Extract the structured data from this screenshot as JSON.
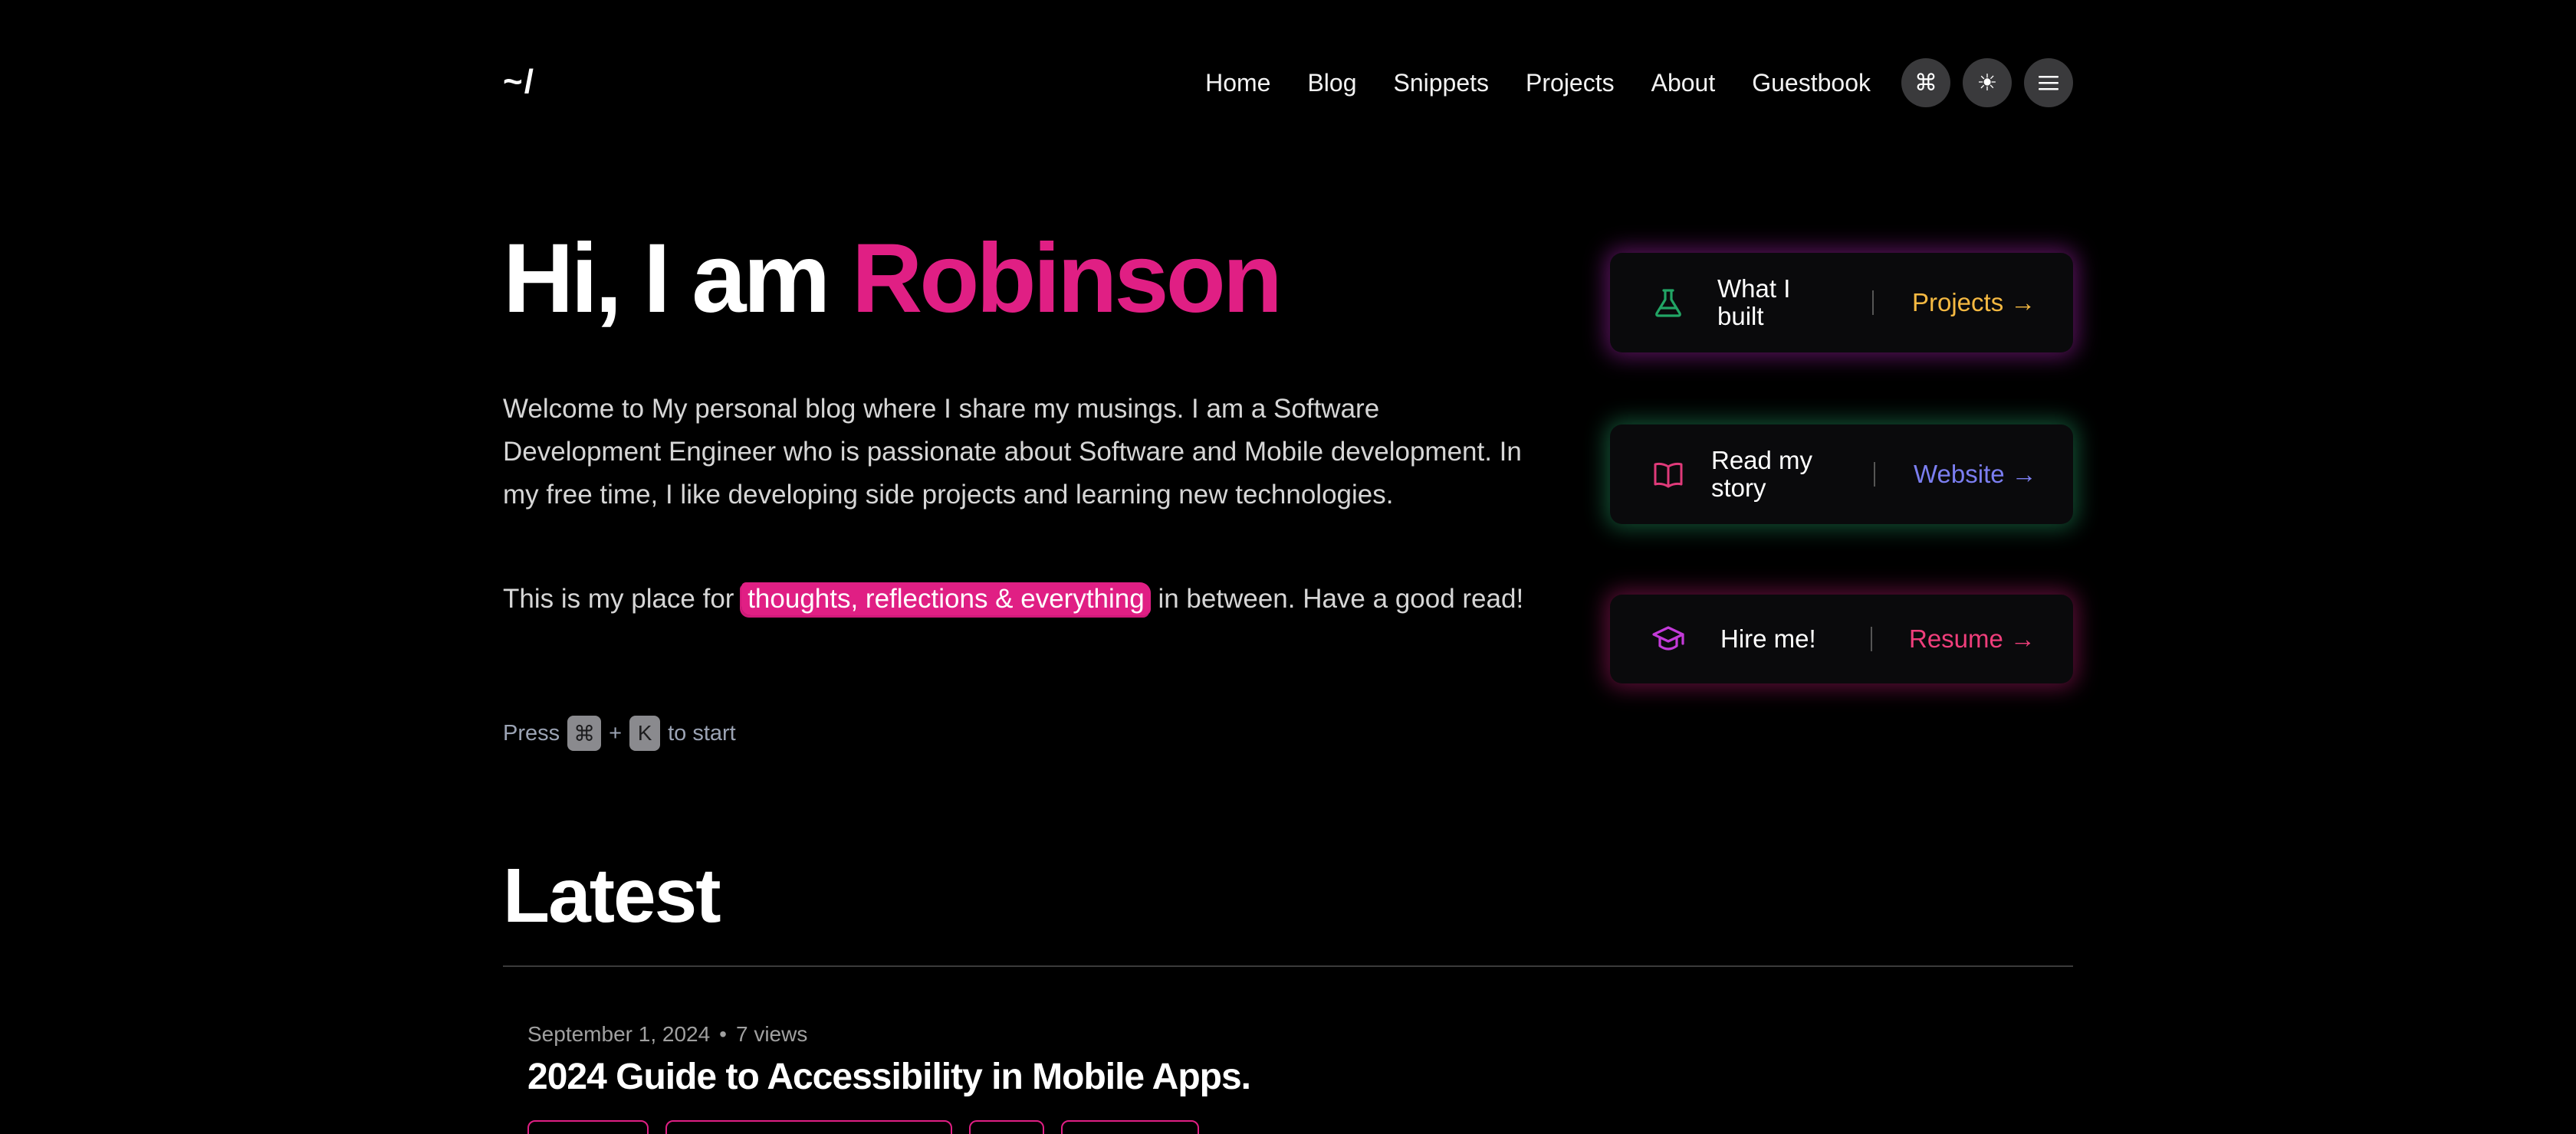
{
  "header": {
    "logo": "~/",
    "nav": [
      "Home",
      "Blog",
      "Snippets",
      "Projects",
      "About",
      "Guestbook"
    ],
    "icons": [
      "command-icon",
      "sun-icon",
      "menu-icon"
    ],
    "command_glyph": "⌘",
    "sun_glyph": "☀"
  },
  "hero": {
    "greeting": "Hi, I am",
    "name": "Robinson",
    "intro": "Welcome to My personal blog where I share my musings. I am a Software Development Engineer who is passionate about Software and Mobile development. In my free time, I like developing side projects and learning new technologies.",
    "place_before": "This is my place for",
    "place_highlight": "thoughts, reflections & everything",
    "place_after": "in between. Have a good read!",
    "press_label": "Press",
    "press_key1": "⌘",
    "press_plus": "+",
    "press_key2": "K",
    "press_suffix": "to start"
  },
  "cards": [
    {
      "text": "What I built",
      "link": "Projects →",
      "link_color": "#f5b942",
      "icon": "flask-icon",
      "icon_color": "#22a565"
    },
    {
      "text": "Read my story",
      "link": "Website →",
      "link_color": "#7b7ef0",
      "icon": "book-icon",
      "icon_color": "#e03a7a"
    },
    {
      "text": "Hire me!",
      "link": "Resume →",
      "link_color": "#ef3e7b",
      "icon": "graduation-cap-icon",
      "icon_color": "#c33ad9"
    }
  ],
  "latest": {
    "heading": "Latest",
    "post": {
      "date": "September 1, 2024",
      "bullet": "•",
      "views": "7 views",
      "title": "2024 Guide to Accessibility in Mobile Apps."
    }
  },
  "colors": {
    "accent": "#e01f84",
    "background": "#000000"
  }
}
